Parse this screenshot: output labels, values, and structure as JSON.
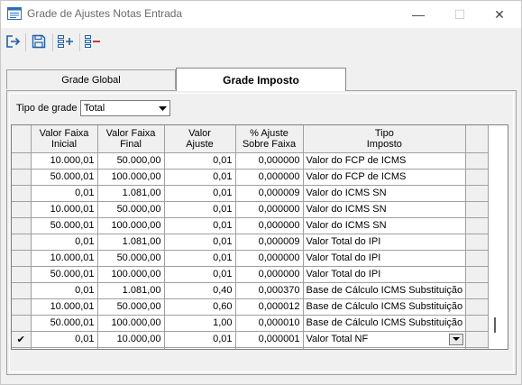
{
  "window": {
    "title": "Grade de Ajustes Notas Entrada",
    "minimize": "—",
    "maximize": "☐",
    "close": "✕"
  },
  "toolbar": {
    "exit_icon": "exit-icon",
    "save_icon": "save-icon",
    "add_icon": "add-row-icon",
    "remove_icon": "remove-row-icon"
  },
  "tabs": [
    {
      "label": "Grade Global"
    },
    {
      "label": "Grade Imposto"
    }
  ],
  "filter": {
    "label": "Tipo de grade",
    "value": "Total"
  },
  "table": {
    "headers": [
      [
        "Valor Faixa",
        "Inicial"
      ],
      [
        "Valor Faixa",
        "Final"
      ],
      [
        "Valor",
        "Ajuste"
      ],
      [
        "% Ajuste",
        "Sobre Faixa"
      ],
      [
        "Tipo",
        "Imposto"
      ]
    ],
    "rows": [
      [
        "10.000,01",
        "50.000,00",
        "0,01",
        "0,000000",
        "Valor do FCP de ICMS"
      ],
      [
        "50.000,01",
        "100.000,00",
        "0,01",
        "0,000000",
        "Valor do FCP de ICMS"
      ],
      [
        "0,01",
        "1.081,00",
        "0,01",
        "0,000009",
        "Valor do ICMS SN"
      ],
      [
        "10.000,01",
        "50.000,00",
        "0,01",
        "0,000000",
        "Valor do ICMS SN"
      ],
      [
        "50.000,01",
        "100.000,00",
        "0,01",
        "0,000000",
        "Valor do ICMS SN"
      ],
      [
        "0,01",
        "1.081,00",
        "0,01",
        "0,000009",
        "Valor Total do IPI"
      ],
      [
        "10.000,01",
        "50.000,00",
        "0,01",
        "0,000000",
        "Valor Total do IPI"
      ],
      [
        "50.000,01",
        "100.000,00",
        "0,01",
        "0,000000",
        "Valor Total do IPI"
      ],
      [
        "0,01",
        "1.081,00",
        "0,40",
        "0,000370",
        "Base de Cálculo ICMS Substituição"
      ],
      [
        "10.000,01",
        "50.000,00",
        "0,60",
        "0,000012",
        "Base de Cálculo ICMS Substituição"
      ],
      [
        "50.000,01",
        "100.000,00",
        "1,00",
        "0,000010",
        "Base de Cálculo ICMS Substituição"
      ],
      [
        "0,01",
        "10.000,00",
        "0,01",
        "0,000001",
        "Valor Total NF"
      ]
    ],
    "current_row_indicator": "✔"
  }
}
